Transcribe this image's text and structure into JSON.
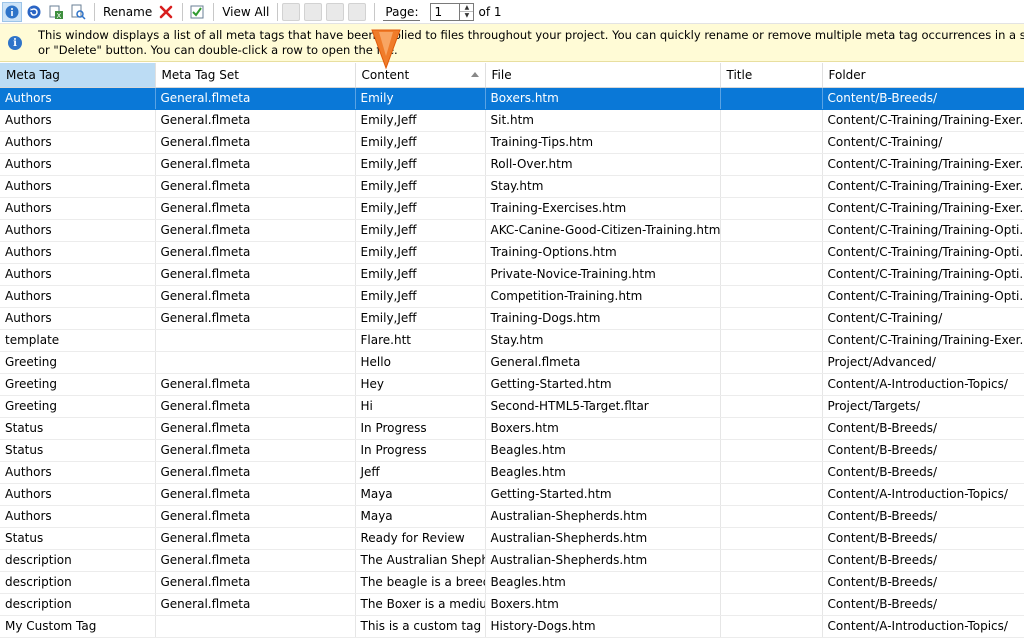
{
  "toolbar": {
    "rename_label": "Rename",
    "view_all_label": "View All",
    "page_label": "Page:",
    "page_value": "1",
    "of_label": "of 1",
    "colors": {
      "delete": "#d81e1e",
      "info": "#2f74c9",
      "refresh": "#2a64c4"
    }
  },
  "info": {
    "line1": "This window displays a list of all meta tags that have been applied to files throughout your project. You can quickly rename or remove multiple meta tag occurrences in a single batch. Select",
    "line2": "or \"Delete\" button. You can double-click a row to open the file."
  },
  "grid": {
    "columns": [
      "Meta Tag",
      "Meta Tag Set",
      "Content",
      "File",
      "Title",
      "Folder"
    ],
    "sorted_column": "Content",
    "selected_row": 0,
    "rows": [
      [
        "Authors",
        "General.flmeta",
        "Emily",
        "Boxers.htm",
        "",
        "Content/B-Breeds/"
      ],
      [
        "Authors",
        "General.flmeta",
        "Emily,Jeff",
        "Sit.htm",
        "",
        "Content/C-Training/Training-Exer..."
      ],
      [
        "Authors",
        "General.flmeta",
        "Emily,Jeff",
        "Training-Tips.htm",
        "",
        "Content/C-Training/"
      ],
      [
        "Authors",
        "General.flmeta",
        "Emily,Jeff",
        "Roll-Over.htm",
        "",
        "Content/C-Training/Training-Exer..."
      ],
      [
        "Authors",
        "General.flmeta",
        "Emily,Jeff",
        "Stay.htm",
        "",
        "Content/C-Training/Training-Exer..."
      ],
      [
        "Authors",
        "General.flmeta",
        "Emily,Jeff",
        "Training-Exercises.htm",
        "",
        "Content/C-Training/Training-Exer..."
      ],
      [
        "Authors",
        "General.flmeta",
        "Emily,Jeff",
        "AKC-Canine-Good-Citizen-Training.htm",
        "",
        "Content/C-Training/Training-Opti..."
      ],
      [
        "Authors",
        "General.flmeta",
        "Emily,Jeff",
        "Training-Options.htm",
        "",
        "Content/C-Training/Training-Opti..."
      ],
      [
        "Authors",
        "General.flmeta",
        "Emily,Jeff",
        "Private-Novice-Training.htm",
        "",
        "Content/C-Training/Training-Opti..."
      ],
      [
        "Authors",
        "General.flmeta",
        "Emily,Jeff",
        "Competition-Training.htm",
        "",
        "Content/C-Training/Training-Opti..."
      ],
      [
        "Authors",
        "General.flmeta",
        "Emily,Jeff",
        "Training-Dogs.htm",
        "",
        "Content/C-Training/"
      ],
      [
        "template",
        "",
        "Flare.htt",
        "Stay.htm",
        "",
        "Content/C-Training/Training-Exer..."
      ],
      [
        "Greeting",
        "",
        "Hello",
        "General.flmeta",
        "",
        "Project/Advanced/"
      ],
      [
        "Greeting",
        "General.flmeta",
        "Hey",
        "Getting-Started.htm",
        "",
        "Content/A-Introduction-Topics/"
      ],
      [
        "Greeting",
        "General.flmeta",
        "Hi",
        "Second-HTML5-Target.fltar",
        "",
        "Project/Targets/"
      ],
      [
        "Status",
        "General.flmeta",
        "In Progress",
        "Boxers.htm",
        "",
        "Content/B-Breeds/"
      ],
      [
        "Status",
        "General.flmeta",
        "In Progress",
        "Beagles.htm",
        "",
        "Content/B-Breeds/"
      ],
      [
        "Authors",
        "General.flmeta",
        "Jeff",
        "Beagles.htm",
        "",
        "Content/B-Breeds/"
      ],
      [
        "Authors",
        "General.flmeta",
        "Maya",
        "Getting-Started.htm",
        "",
        "Content/A-Introduction-Topics/"
      ],
      [
        "Authors",
        "General.flmeta",
        "Maya",
        "Australian-Shepherds.htm",
        "",
        "Content/B-Breeds/"
      ],
      [
        "Status",
        "General.flmeta",
        "Ready for Review",
        "Australian-Shepherds.htm",
        "",
        "Content/B-Breeds/"
      ],
      [
        "description",
        "General.flmeta",
        "The Australian Sheph...",
        "Australian-Shepherds.htm",
        "",
        "Content/B-Breeds/"
      ],
      [
        "description",
        "General.flmeta",
        "The beagle is a breed...",
        "Beagles.htm",
        "",
        "Content/B-Breeds/"
      ],
      [
        "description",
        "General.flmeta",
        "The Boxer is a mediu...",
        "Boxers.htm",
        "",
        "Content/B-Breeds/"
      ],
      [
        "My Custom Tag",
        "",
        "This is a custom tag f...",
        "History-Dogs.htm",
        "",
        "Content/A-Introduction-Topics/"
      ]
    ]
  }
}
